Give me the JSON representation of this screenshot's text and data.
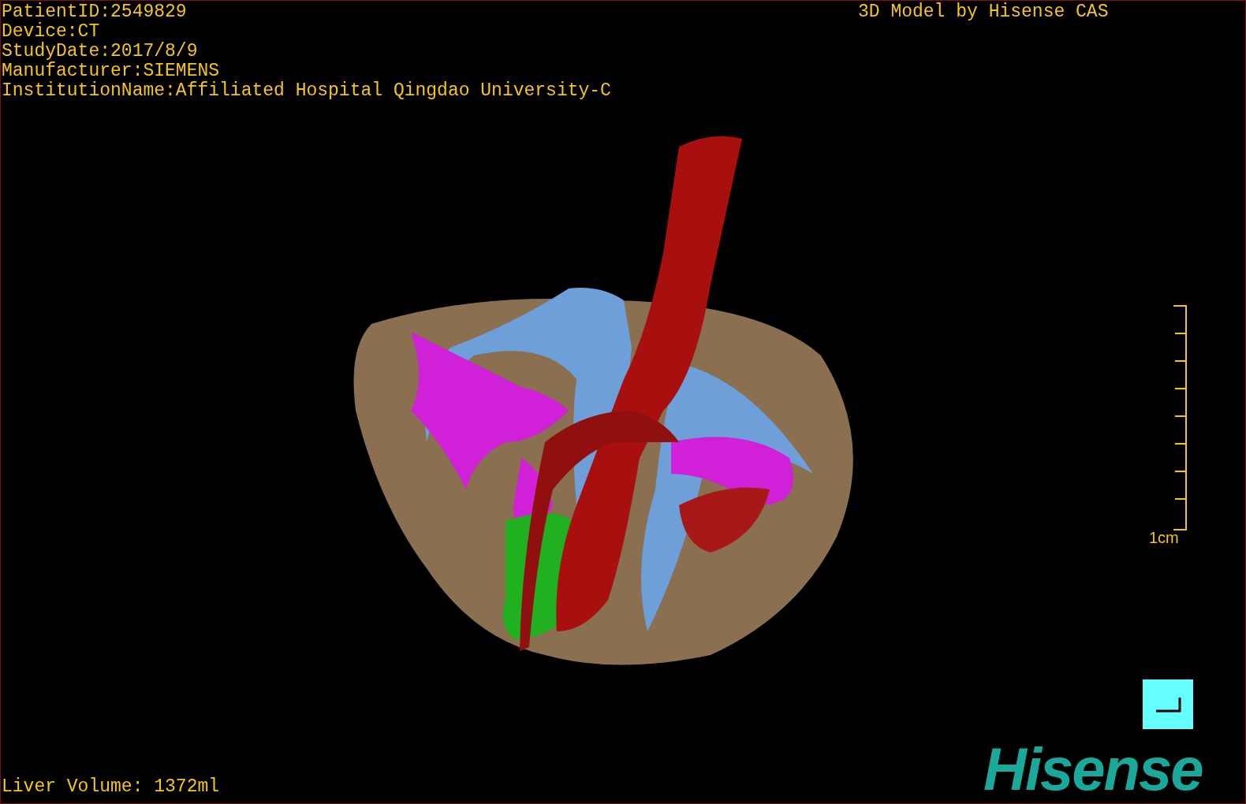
{
  "info_lines": [
    "PatientID:2549829",
    "Device:CT",
    "StudyDate:2017/8/9",
    "Manufacturer:SIEMENS",
    "InstitutionName:Affiliated Hospital Qingdao University-C"
  ],
  "model_caption": "3D Model by Hisense CAS",
  "scale_bar": {
    "label": "1cm"
  },
  "liver_volume": "Liver Volume: 1372ml",
  "logo": "Hisense"
}
